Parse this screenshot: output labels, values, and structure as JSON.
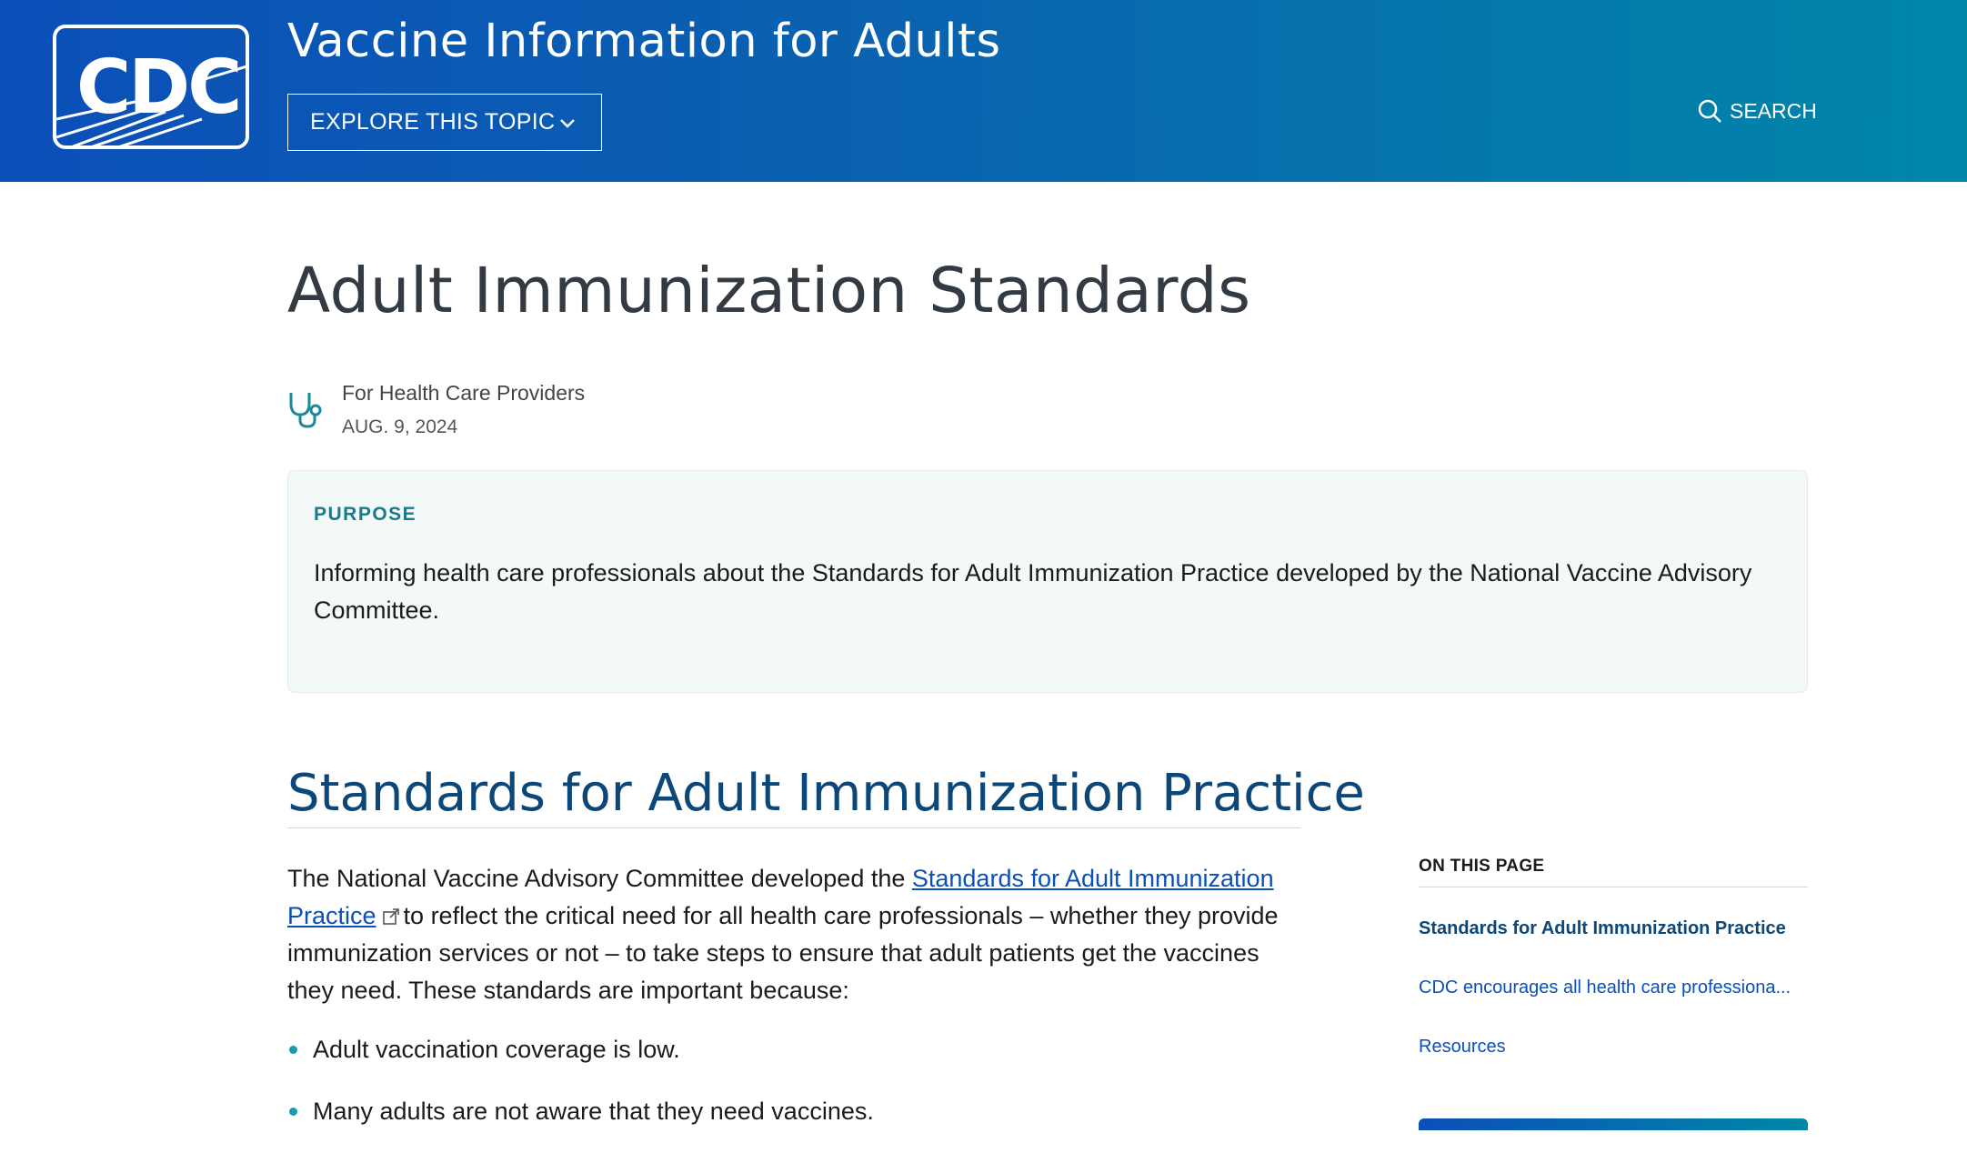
{
  "header": {
    "logo_text": "CDC",
    "site_title": "Vaccine Information for Adults",
    "explore_label": "EXPLORE THIS TOPIC",
    "search_label": "SEARCH"
  },
  "page": {
    "title": "Adult Immunization Standards",
    "audience": "For Health Care Providers",
    "date": "AUG. 9, 2024"
  },
  "purpose": {
    "label": "PURPOSE",
    "text": "Informing health care professionals about the Standards for Adult Immunization Practice developed by the National Vaccine Advisory Committee."
  },
  "section": {
    "title": "Standards for Adult Immunization Practice",
    "para_before": "The National Vaccine Advisory Committee developed the ",
    "link_text": "Standards for Adult Immunization Practice",
    "para_after": "to reflect the critical need for all health care professionals – whether they provide immunization services or not – to take steps to ensure that adult patients get the vaccines they need. These standards are important because:",
    "bullets": [
      "Adult vaccination coverage is low.",
      "Many adults are not aware that they need vaccines."
    ]
  },
  "toc": {
    "heading": "ON THIS PAGE",
    "items": [
      "Standards for Adult Immunization Practice",
      "CDC encourages all health care professiona...",
      "Resources"
    ]
  },
  "colors": {
    "header_start": "#0b4fb8",
    "header_end": "#0087a8",
    "link": "#0b4fb8",
    "heading": "#0b4778",
    "accent": "#1a7a8a",
    "purpose_bg": "#f2f9f8"
  },
  "icons": [
    "cdc-logo",
    "chevron-down-icon",
    "search-icon",
    "stethoscope-icon",
    "external-link-icon",
    "bullet-dot"
  ]
}
